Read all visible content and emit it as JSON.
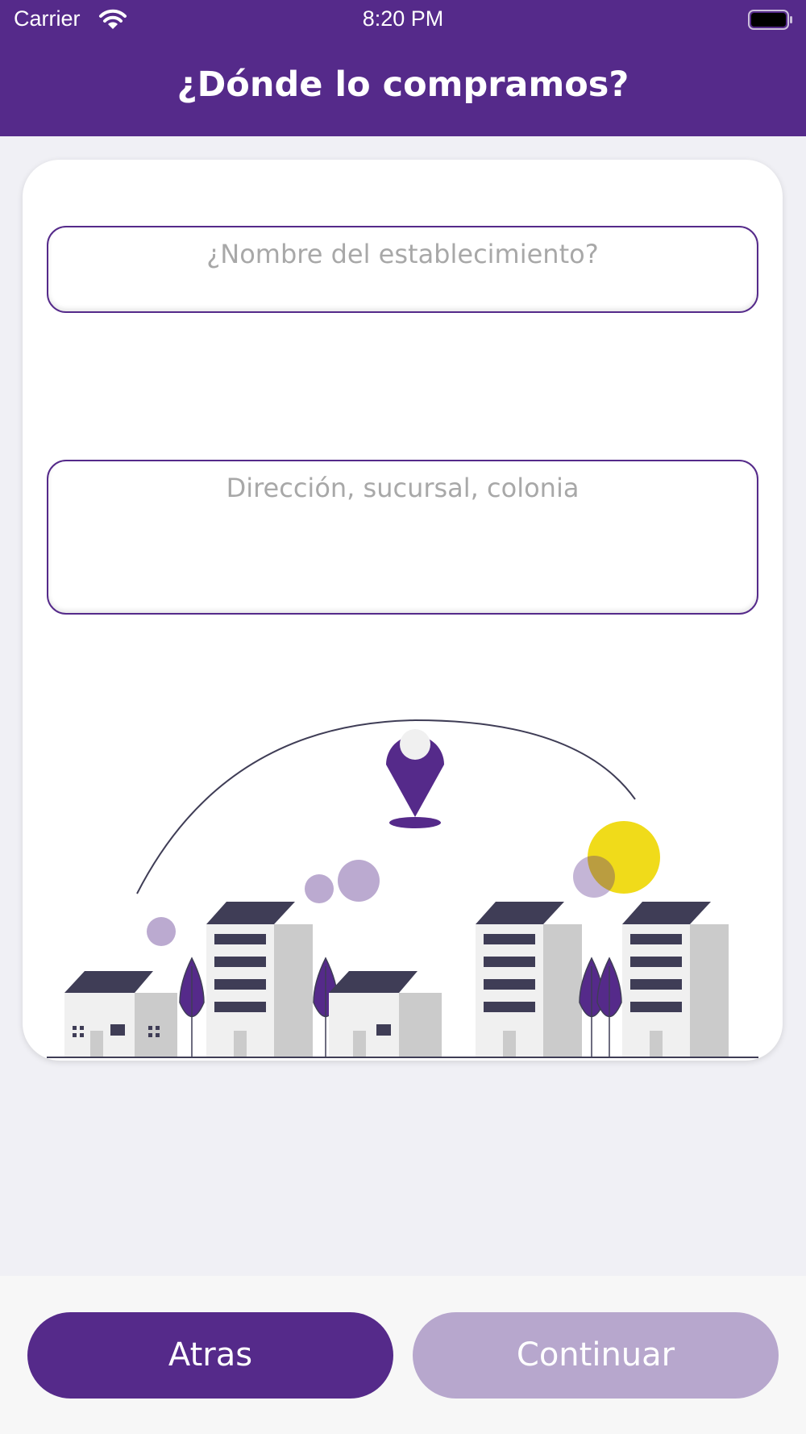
{
  "status_bar": {
    "carrier": "Carrier",
    "time": "8:20 PM"
  },
  "header": {
    "title": "¿Dónde lo compramos?"
  },
  "form": {
    "store_name_placeholder": "¿Nombre del establecimiento?",
    "address_placeholder": "Dirección, sucursal, colonia"
  },
  "buttons": {
    "back_label": "Atras",
    "continue_label": "Continuar"
  },
  "colors": {
    "brand": "#552a8a",
    "disabled": "#b7a7cd",
    "accent_sun": "#f0db1a"
  }
}
